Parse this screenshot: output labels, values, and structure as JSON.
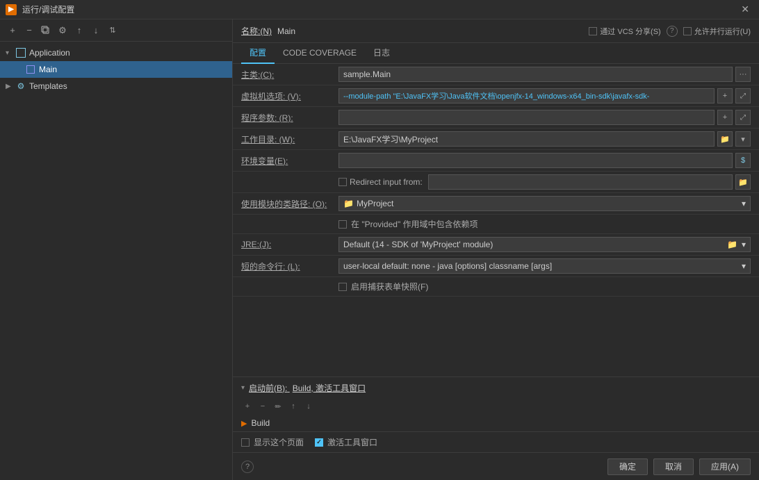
{
  "title_bar": {
    "icon": "▶",
    "title": "运行/调试配置",
    "close": "✕"
  },
  "left_panel": {
    "toolbar": {
      "add": "+",
      "remove": "−",
      "copy": "⧉",
      "settings": "⚙",
      "up": "↑",
      "down": "↓",
      "sort": "⇅"
    },
    "tree": {
      "application": {
        "label": "Application",
        "expanded": true,
        "children": [
          {
            "label": "Main",
            "selected": true
          }
        ]
      },
      "templates": {
        "label": "Templates",
        "expanded": false
      }
    }
  },
  "header": {
    "name_label": "名称:(N)",
    "name_value": "Main",
    "vcs_label": "通过 VCS 分享(S)",
    "parallel_label": "允许并行运行(U)"
  },
  "tabs": [
    {
      "id": "config",
      "label": "配置",
      "active": true
    },
    {
      "id": "coverage",
      "label": "CODE COVERAGE",
      "active": false
    },
    {
      "id": "log",
      "label": "日志",
      "active": false
    }
  ],
  "form": {
    "class_label": "主类:(C):",
    "class_value": "sample.Main",
    "vm_label": "虚拟机选项: (V):",
    "vm_value": "--module-path \"E:\\JavaFX学习\\Java软件文档\\openjfx-14_windows-x64_bin-sdk\\javafx-sdk-",
    "program_label": "程序参数: (R):",
    "program_value": "",
    "workdir_label": "工作目录: (W):",
    "workdir_value": "E:\\JavaFX学习\\MyProject",
    "env_label": "环境变量(E):",
    "env_value": "",
    "redirect_label": "Redirect input from:",
    "redirect_value": "",
    "redirect_checked": false,
    "module_class_label": "使用模块的类路径: (O):",
    "module_class_value": "MyProject",
    "include_provided_label": "在 \"Provided\" 作用域中包含依赖项",
    "include_provided_checked": false,
    "jre_label": "JRE:(J):",
    "jre_value": "Default (14 - SDK of 'MyProject' module)",
    "short_cmd_label": "短的命令行: (L):",
    "short_cmd_value": "user-local default: none - java [options] classname [args]",
    "shortcut_label": "启用捕获表单快照(F)",
    "shortcut_checked": false
  },
  "before_launch": {
    "header_label": "启动前(B):",
    "header_value": "Build, 激活工具窗口",
    "build_item": "Build",
    "show_page_label": "显示这个页面",
    "show_page_checked": false,
    "activate_label": "激活工具窗口",
    "activate_checked": true
  },
  "footer": {
    "confirm": "确定",
    "cancel": "取消",
    "apply": "应用(A)"
  }
}
